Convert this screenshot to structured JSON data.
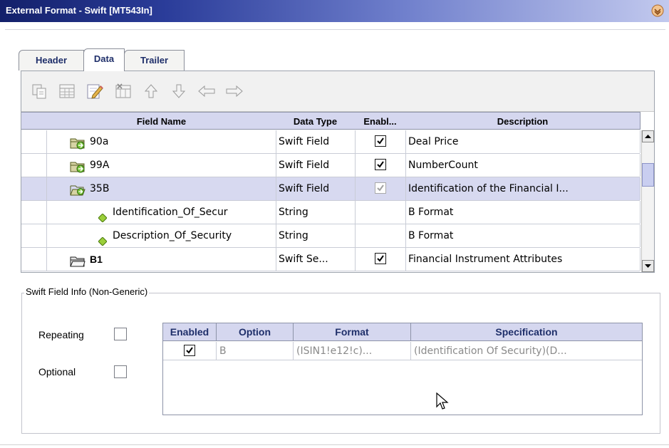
{
  "window": {
    "title": "External Format - Swift [MT543In]"
  },
  "tabs": [
    {
      "label": "Header",
      "active": false
    },
    {
      "label": "Data",
      "active": true
    },
    {
      "label": "Trailer",
      "active": false
    }
  ],
  "toolbar": {
    "icons": [
      "copy-icon",
      "table-icon",
      "edit-icon",
      "delete-icon",
      "move-up-icon",
      "move-down-icon",
      "move-left-icon",
      "move-right-icon"
    ]
  },
  "grid": {
    "columns": [
      "Field Name",
      "Data Type",
      "Enabl...",
      "Description"
    ],
    "rows": [
      {
        "name": "90a",
        "type": "Swift Field",
        "enabled": true,
        "desc": "Deal Price",
        "icon": "folder-icon",
        "selected": false
      },
      {
        "name": "99A",
        "type": "Swift Field",
        "enabled": true,
        "desc": "NumberCount",
        "icon": "folder-icon",
        "selected": false
      },
      {
        "name": "35B",
        "type": "Swift Field",
        "enabled": true,
        "desc": "Identification of the Financial I...",
        "icon": "open-folder-icon",
        "selected": true
      },
      {
        "name": "Identification_Of_Secur",
        "type": "String",
        "enabled": null,
        "desc": "B Format",
        "icon": "diamond-icon",
        "selected": false
      },
      {
        "name": "Description_Of_Security",
        "type": "String",
        "enabled": null,
        "desc": "B Format",
        "icon": "diamond-icon",
        "selected": false
      },
      {
        "name": "B1",
        "type": "Swift Se...",
        "enabled": true,
        "desc": "Financial Instrument Attributes",
        "icon": "folder-icon",
        "selected": false
      }
    ]
  },
  "fieldinfo": {
    "legend": "Swift Field Info (Non-Generic)",
    "repeating_label": "Repeating",
    "optional_label": "Optional",
    "columns": [
      "Enabled",
      "Option",
      "Format",
      "Specification"
    ],
    "row": {
      "enabled": true,
      "option": "B",
      "format": "(ISIN1!e12!c)...",
      "spec": "(Identification Of Security)(D..."
    }
  }
}
